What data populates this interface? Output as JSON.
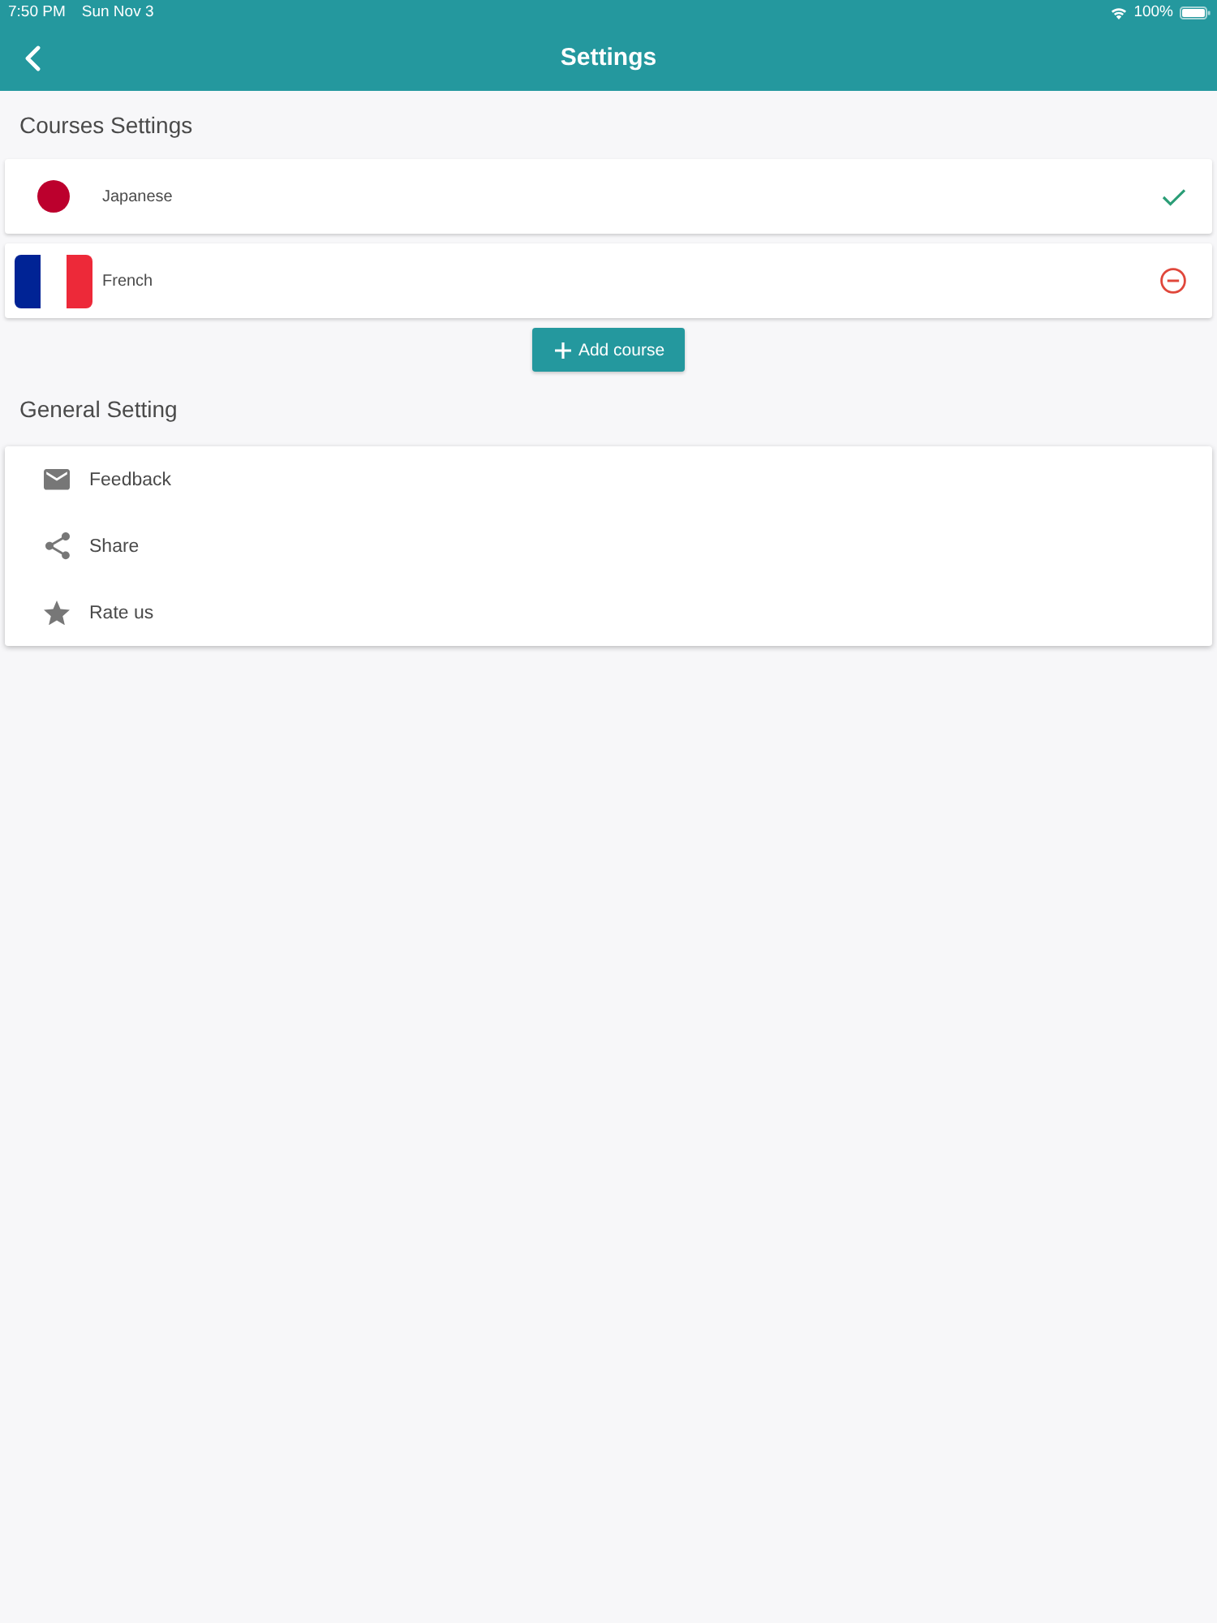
{
  "status_bar": {
    "time": "7:50 PM",
    "date": "Sun Nov 3",
    "battery": "100%"
  },
  "header": {
    "title": "Settings"
  },
  "courses_section": {
    "title": "Courses Settings",
    "courses": [
      {
        "name": "Japanese",
        "selected": true
      },
      {
        "name": "French",
        "selected": false
      }
    ],
    "add_button": "Add course"
  },
  "general_section": {
    "title": "General Setting",
    "items": [
      {
        "label": "Feedback"
      },
      {
        "label": "Share"
      },
      {
        "label": "Rate us"
      }
    ]
  }
}
